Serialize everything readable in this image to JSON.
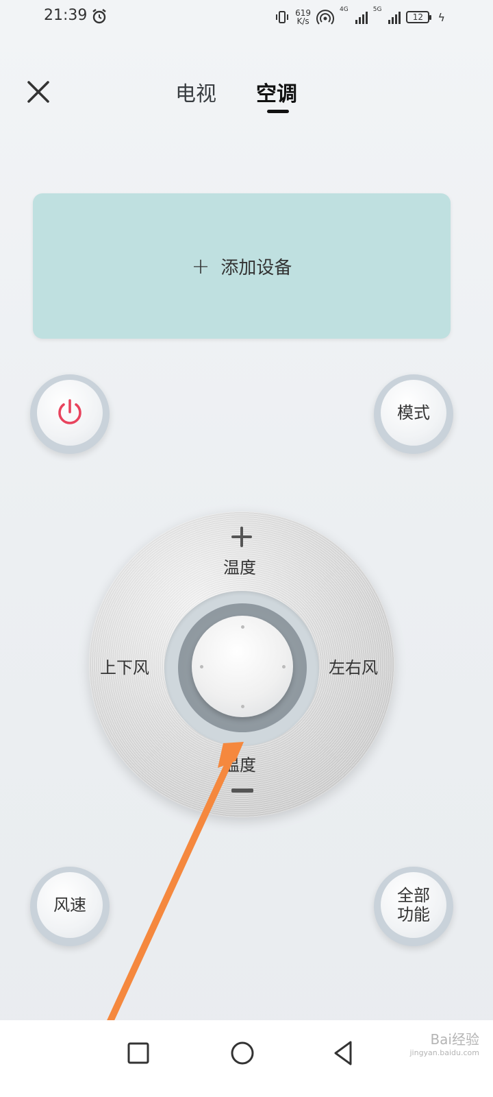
{
  "status_bar": {
    "time": "21:39",
    "speed_value": "619",
    "speed_unit": "K/s",
    "network_4g": "4G",
    "network_5g": "5G",
    "battery": "12"
  },
  "header": {
    "tabs": [
      {
        "label": "电视"
      },
      {
        "label": "空调"
      }
    ]
  },
  "add_device": {
    "plus": "+",
    "label": "添加设备"
  },
  "buttons": {
    "mode": "模式",
    "wind_speed": "风速",
    "all_functions_line1": "全部",
    "all_functions_line2": "功能"
  },
  "dial": {
    "temp_up_label": "温度",
    "temp_down_label": "温度",
    "vertical_swing_label": "上下风",
    "horizontal_swing_label": "左右风"
  },
  "colors": {
    "power_icon": "#e8435d",
    "card_bg": "#bfe0e0",
    "arrow": "#f5883e"
  },
  "watermark": {
    "brand": "Bai经验",
    "url": "jingyan.baidu.com"
  }
}
